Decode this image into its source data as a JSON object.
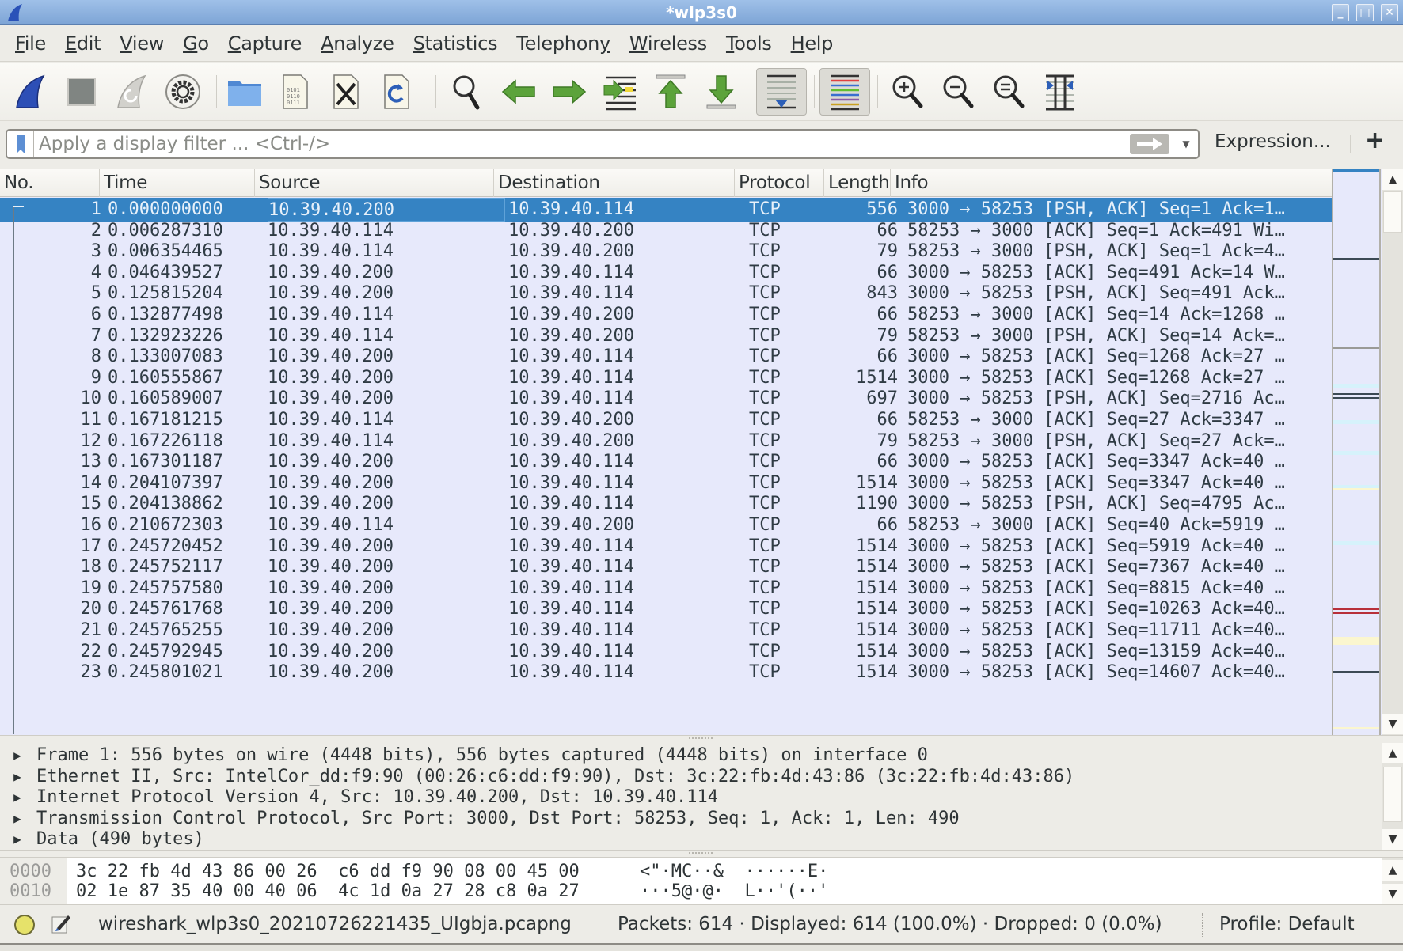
{
  "window": {
    "title": "*wlp3s0",
    "controls": [
      "minimize",
      "maximize",
      "close"
    ]
  },
  "menu": [
    {
      "label": "File",
      "mnemonic": "F"
    },
    {
      "label": "Edit",
      "mnemonic": "E"
    },
    {
      "label": "View",
      "mnemonic": "V"
    },
    {
      "label": "Go",
      "mnemonic": "G"
    },
    {
      "label": "Capture",
      "mnemonic": "C"
    },
    {
      "label": "Analyze",
      "mnemonic": "A"
    },
    {
      "label": "Statistics",
      "mnemonic": "S"
    },
    {
      "label": "Telephony",
      "mnemonic": "y"
    },
    {
      "label": "Wireless",
      "mnemonic": "W"
    },
    {
      "label": "Tools",
      "mnemonic": "T"
    },
    {
      "label": "Help",
      "mnemonic": "H"
    }
  ],
  "toolbar": [
    {
      "icon": "shark-fin-start-capture-icon",
      "pressed": false
    },
    {
      "icon": "stop-capture-icon",
      "pressed": false
    },
    {
      "icon": "restart-capture-icon",
      "pressed": false
    },
    {
      "icon": "capture-options-gear-icon",
      "pressed": false
    },
    {
      "icon": "open-file-folder-icon",
      "pressed": false
    },
    {
      "icon": "save-file-icon",
      "pressed": false
    },
    {
      "icon": "close-file-icon",
      "pressed": false
    },
    {
      "icon": "reload-file-icon",
      "pressed": false
    },
    {
      "icon": "find-packet-magnifier-icon",
      "pressed": false
    },
    {
      "icon": "go-back-arrow-icon",
      "pressed": false
    },
    {
      "icon": "go-forward-arrow-icon",
      "pressed": false
    },
    {
      "icon": "go-to-packet-icon",
      "pressed": false
    },
    {
      "icon": "go-first-packet-icon",
      "pressed": false
    },
    {
      "icon": "go-last-packet-icon",
      "pressed": false
    },
    {
      "icon": "auto-scroll-icon",
      "pressed": true
    },
    {
      "icon": "colorize-list-icon",
      "pressed": true
    },
    {
      "icon": "zoom-in-icon",
      "pressed": false
    },
    {
      "icon": "zoom-out-icon",
      "pressed": false
    },
    {
      "icon": "normal-size-icon",
      "pressed": false
    },
    {
      "icon": "resize-columns-icon",
      "pressed": false
    }
  ],
  "filter": {
    "placeholder": "Apply a display filter ... <Ctrl-/>",
    "value": "",
    "expression_label": "Expression...",
    "add_label": "+"
  },
  "packet_list": {
    "columns": [
      "No.",
      "Time",
      "Source",
      "Destination",
      "Protocol",
      "Length",
      "Info"
    ],
    "selected_row": 0,
    "rows": [
      {
        "no": "1",
        "time": "0.000000000",
        "src": "10.39.40.200",
        "dst": "10.39.40.114",
        "proto": "TCP",
        "len": "556",
        "info": "3000 → 58253 [PSH, ACK] Seq=1 Ack=1…"
      },
      {
        "no": "2",
        "time": "0.006287310",
        "src": "10.39.40.114",
        "dst": "10.39.40.200",
        "proto": "TCP",
        "len": "66",
        "info": "58253 → 3000 [ACK] Seq=1 Ack=491 Wi…"
      },
      {
        "no": "3",
        "time": "0.006354465",
        "src": "10.39.40.114",
        "dst": "10.39.40.200",
        "proto": "TCP",
        "len": "79",
        "info": "58253 → 3000 [PSH, ACK] Seq=1 Ack=4…"
      },
      {
        "no": "4",
        "time": "0.046439527",
        "src": "10.39.40.200",
        "dst": "10.39.40.114",
        "proto": "TCP",
        "len": "66",
        "info": "3000 → 58253 [ACK] Seq=491 Ack=14 W…"
      },
      {
        "no": "5",
        "time": "0.125815204",
        "src": "10.39.40.200",
        "dst": "10.39.40.114",
        "proto": "TCP",
        "len": "843",
        "info": "3000 → 58253 [PSH, ACK] Seq=491 Ack…"
      },
      {
        "no": "6",
        "time": "0.132877498",
        "src": "10.39.40.114",
        "dst": "10.39.40.200",
        "proto": "TCP",
        "len": "66",
        "info": "58253 → 3000 [ACK] Seq=14 Ack=1268 …"
      },
      {
        "no": "7",
        "time": "0.132923226",
        "src": "10.39.40.114",
        "dst": "10.39.40.200",
        "proto": "TCP",
        "len": "79",
        "info": "58253 → 3000 [PSH, ACK] Seq=14 Ack=…"
      },
      {
        "no": "8",
        "time": "0.133007083",
        "src": "10.39.40.200",
        "dst": "10.39.40.114",
        "proto": "TCP",
        "len": "66",
        "info": "3000 → 58253 [ACK] Seq=1268 Ack=27 …"
      },
      {
        "no": "9",
        "time": "0.160555867",
        "src": "10.39.40.200",
        "dst": "10.39.40.114",
        "proto": "TCP",
        "len": "1514",
        "info": "3000 → 58253 [ACK] Seq=1268 Ack=27 …"
      },
      {
        "no": "10",
        "time": "0.160589007",
        "src": "10.39.40.200",
        "dst": "10.39.40.114",
        "proto": "TCP",
        "len": "697",
        "info": "3000 → 58253 [PSH, ACK] Seq=2716 Ac…"
      },
      {
        "no": "11",
        "time": "0.167181215",
        "src": "10.39.40.114",
        "dst": "10.39.40.200",
        "proto": "TCP",
        "len": "66",
        "info": "58253 → 3000 [ACK] Seq=27 Ack=3347 …"
      },
      {
        "no": "12",
        "time": "0.167226118",
        "src": "10.39.40.114",
        "dst": "10.39.40.200",
        "proto": "TCP",
        "len": "79",
        "info": "58253 → 3000 [PSH, ACK] Seq=27 Ack=…"
      },
      {
        "no": "13",
        "time": "0.167301187",
        "src": "10.39.40.200",
        "dst": "10.39.40.114",
        "proto": "TCP",
        "len": "66",
        "info": "3000 → 58253 [ACK] Seq=3347 Ack=40 …"
      },
      {
        "no": "14",
        "time": "0.204107397",
        "src": "10.39.40.200",
        "dst": "10.39.40.114",
        "proto": "TCP",
        "len": "1514",
        "info": "3000 → 58253 [ACK] Seq=3347 Ack=40 …"
      },
      {
        "no": "15",
        "time": "0.204138862",
        "src": "10.39.40.200",
        "dst": "10.39.40.114",
        "proto": "TCP",
        "len": "1190",
        "info": "3000 → 58253 [PSH, ACK] Seq=4795 Ac…"
      },
      {
        "no": "16",
        "time": "0.210672303",
        "src": "10.39.40.114",
        "dst": "10.39.40.200",
        "proto": "TCP",
        "len": "66",
        "info": "58253 → 3000 [ACK] Seq=40 Ack=5919 …"
      },
      {
        "no": "17",
        "time": "0.245720452",
        "src": "10.39.40.200",
        "dst": "10.39.40.114",
        "proto": "TCP",
        "len": "1514",
        "info": "3000 → 58253 [ACK] Seq=5919 Ack=40 …"
      },
      {
        "no": "18",
        "time": "0.245752117",
        "src": "10.39.40.200",
        "dst": "10.39.40.114",
        "proto": "TCP",
        "len": "1514",
        "info": "3000 → 58253 [ACK] Seq=7367 Ack=40 …"
      },
      {
        "no": "19",
        "time": "0.245757580",
        "src": "10.39.40.200",
        "dst": "10.39.40.114",
        "proto": "TCP",
        "len": "1514",
        "info": "3000 → 58253 [ACK] Seq=8815 Ack=40 …"
      },
      {
        "no": "20",
        "time": "0.245761768",
        "src": "10.39.40.200",
        "dst": "10.39.40.114",
        "proto": "TCP",
        "len": "1514",
        "info": "3000 → 58253 [ACK] Seq=10263 Ack=40…"
      },
      {
        "no": "21",
        "time": "0.245765255",
        "src": "10.39.40.200",
        "dst": "10.39.40.114",
        "proto": "TCP",
        "len": "1514",
        "info": "3000 → 58253 [ACK] Seq=11711 Ack=40…"
      },
      {
        "no": "22",
        "time": "0.245792945",
        "src": "10.39.40.200",
        "dst": "10.39.40.114",
        "proto": "TCP",
        "len": "1514",
        "info": "3000 → 58253 [ACK] Seq=13159 Ack=40…"
      },
      {
        "no": "23",
        "time": "0.245801021",
        "src": "10.39.40.200",
        "dst": "10.39.40.114",
        "proto": "TCP",
        "len": "1514",
        "info": "3000 → 58253 [ACK] Seq=14607 Ack=40…"
      }
    ]
  },
  "colors": {
    "row_bg": "#e7e9fb",
    "selected_bg": "#3583c3",
    "minimap_dark": "#3c4a55",
    "minimap_red": "#b8303a",
    "minimap_yellow": "#fbf6cf",
    "minimap_cyan": "#d6f2fb"
  },
  "minimap_marks": [
    {
      "pos": 0.158,
      "kind": "dark"
    },
    {
      "pos": 0.316,
      "kind": "gray"
    },
    {
      "pos": 0.38,
      "kind": "cyan"
    },
    {
      "pos": 0.397,
      "kind": "dark"
    },
    {
      "pos": 0.405,
      "kind": "dark"
    },
    {
      "pos": 0.445,
      "kind": "cyan"
    },
    {
      "pos": 0.5,
      "kind": "cyan"
    },
    {
      "pos": 0.56,
      "kind": "cyan"
    },
    {
      "pos": 0.566,
      "kind": "yellow"
    },
    {
      "pos": 0.66,
      "kind": "cyan"
    },
    {
      "pos": 0.78,
      "kind": "red"
    },
    {
      "pos": 0.787,
      "kind": "red"
    },
    {
      "pos": 0.83,
      "kind": "yellow-band"
    },
    {
      "pos": 0.89,
      "kind": "dark"
    },
    {
      "pos": 0.99,
      "kind": "yellow"
    }
  ],
  "details": [
    {
      "text": "Frame 1: 556 bytes on wire (4448 bits), 556 bytes captured (4448 bits) on interface 0",
      "expanded": false
    },
    {
      "text": "Ethernet II, Src: IntelCor_dd:f9:90 (00:26:c6:dd:f9:90), Dst: 3c:22:fb:4d:43:86 (3c:22:fb:4d:43:86)",
      "expanded": false
    },
    {
      "text": "Internet Protocol Version 4, Src: 10.39.40.200, Dst: 10.39.40.114",
      "expanded": false
    },
    {
      "text": "Transmission Control Protocol, Src Port: 3000, Dst Port: 58253, Seq: 1, Ack: 1, Len: 490",
      "expanded": false
    },
    {
      "text": "Data (490 bytes)",
      "expanded": false
    }
  ],
  "bytes": [
    {
      "offset": "0000",
      "hex": "3c 22 fb 4d 43 86 00 26  c6 dd f9 90 08 00 45 00",
      "ascii": "<\"·MC··&  ······E·"
    },
    {
      "offset": "0010",
      "hex": "02 1e 87 35 40 00 40 06  4c 1d 0a 27 28 c8 0a 27",
      "ascii": "···5@·@·  L··'(··'"
    }
  ],
  "status": {
    "file": "wireshark_wlp3s0_20210726221435_UIgbja.pcapng",
    "stats": "Packets: 614 · Displayed: 614 (100.0%) · Dropped: 0 (0.0%)",
    "profile": "Profile: Default"
  }
}
